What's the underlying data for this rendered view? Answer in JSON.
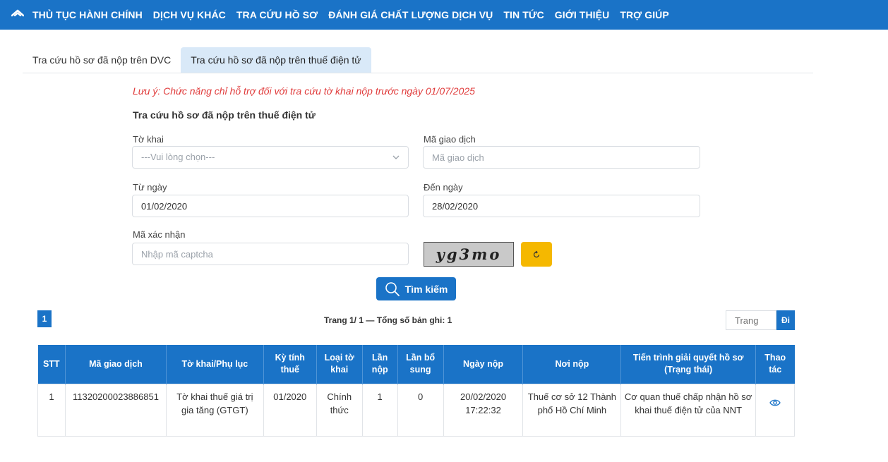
{
  "nav": {
    "home_icon": "home-icon",
    "items": [
      "THỦ TỤC HÀNH CHÍNH",
      "DỊCH VỤ KHÁC",
      "TRA CỨU HỒ SƠ",
      "ĐÁNH GIÁ CHẤT LƯỢNG DỊCH VỤ",
      "TIN TỨC",
      "GIỚI THIỆU",
      "TRỢ GIÚP"
    ]
  },
  "tabs": [
    {
      "label": "Tra cứu hồ sơ đã nộp trên DVC",
      "active": false
    },
    {
      "label": "Tra cứu hồ sơ đã nộp trên thuế điện tử",
      "active": true
    }
  ],
  "form": {
    "note": "Lưu ý: Chức năng chỉ hỗ trợ đối với tra cứu tờ khai nộp trước ngày 01/07/2025",
    "title": "Tra cứu hồ sơ đã nộp trên thuế điện tử",
    "to_khai": {
      "label": "Tờ khai",
      "selected": "---Vui lòng chọn---"
    },
    "ma_giao_dich": {
      "label": "Mã giao dịch",
      "placeholder": "Mã giao dịch",
      "value": ""
    },
    "tu_ngay": {
      "label": "Từ ngày",
      "value": "01/02/2020"
    },
    "den_ngay": {
      "label": "Đến ngày",
      "value": "28/02/2020"
    },
    "captcha": {
      "label": "Mã xác nhận",
      "placeholder": "Nhập mã captcha",
      "image_text": "yg3mo"
    },
    "search_label": "Tìm kiếm"
  },
  "pagination": {
    "current_page": "1",
    "info": "Trang 1/ 1 — Tổng số bản ghi: 1",
    "page_placeholder": "Trang",
    "go_label": "Đi"
  },
  "table": {
    "headers": [
      "STT",
      "Mã giao dịch",
      "Tờ khai/Phụ lục",
      "Kỳ tính thuế",
      "Loại tờ khai",
      "Lần nộp",
      "Lần bổ sung",
      "Ngày nộp",
      "Nơi nộp",
      "Tiến trình giải quyết hồ sơ (Trạng thái)",
      "Thao tác"
    ],
    "rows": [
      {
        "stt": "1",
        "ma_giao_dich": "11320200023886851",
        "to_khai": "Tờ khai thuế giá trị gia tăng (GTGT)",
        "ky_tinh_thue": "01/2020",
        "loai_to_khai": "Chính thức",
        "lan_nop": "1",
        "lan_bo_sung": "0",
        "ngay_nop": "20/02/2020 17:22:32",
        "noi_nop": "Thuế cơ sở 12 Thành phố Hồ Chí Minh",
        "trang_thai": "Cơ quan thuế chấp nhận hồ sơ khai thuế điện tử của NNT",
        "action_icon": "eye-icon"
      }
    ]
  },
  "colors": {
    "primary": "#1a73c7",
    "note": "#e03b3b",
    "refresh": "#f5b800",
    "tab_active": "#d9e9f8"
  }
}
